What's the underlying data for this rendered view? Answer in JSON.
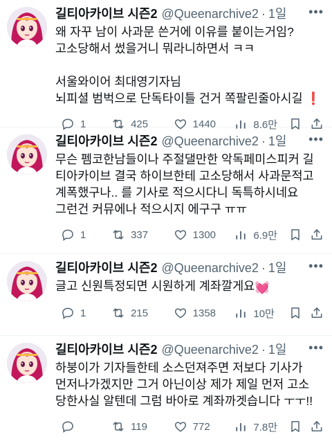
{
  "tweets": [
    {
      "name": "길티아카이브 시즌2",
      "handle": "@Queenarchive2",
      "dot": "·",
      "time": "1일",
      "lines": [
        "왜 자꾸 남이 사과문 쓴거에 이유를 붙이는거임?",
        "고소당해서 썼을거니 뭐라니하면서 ㅋㅋ",
        "",
        "서울와이어 최대영기자님",
        "뇌피셜 범벅으로 단독타이틀 건거 쪽팔린줄아시길"
      ],
      "trailing_emoji": "❗",
      "replies": "1",
      "retweets": "425",
      "likes": "1440",
      "views": "8.6만"
    },
    {
      "name": "길티아카이브 시즌2",
      "handle": "@Queenarchive2",
      "dot": "·",
      "time": "1일",
      "lines": [
        "무슨 펨코한남들이나 주절댈만한 악독페미스피커 길",
        "티아카이브 결국 하이브한테 고소당해서 사과문적고",
        "계폭했구나.. 를 기사로 적으시다니 독특하시네요",
        "그런건 커뮤에나 적으시지 에구구 ㅠㅠ"
      ],
      "replies": "1",
      "retweets": "337",
      "likes": "1300",
      "views": "6.9만"
    },
    {
      "name": "길티아카이브 시즌2",
      "handle": "@Queenarchive2",
      "dot": "·",
      "time": "1일",
      "lines": [
        "글고 신원특정되면 시원하게 계좌깔게요"
      ],
      "trailing_emoji": "💓",
      "replies": "1",
      "retweets": "215",
      "likes": "1358",
      "views": "10만"
    },
    {
      "name": "길티아카이브 시즌2",
      "handle": "@Queenarchive2",
      "dot": "·",
      "time": "1일",
      "lines": [
        "하붕이가 기자들한테 소스던져주면 저보다 기사가",
        "먼저나가겠지만 그거 아닌이상 제가 제일 먼저 고소",
        "당한사실 알텐데 그럼 바아로 계좌까겟습니다 ㅜㅜ!!"
      ],
      "replies": "",
      "retweets": "119",
      "likes": "772",
      "views": "7.8만"
    }
  ],
  "colors": {
    "text": "#0f1419",
    "secondary": "#536471",
    "divider": "#eff3f4",
    "avatar_hair": "#c2185b"
  },
  "icons": [
    "reply-icon",
    "retweet-icon",
    "like-icon",
    "views-icon",
    "bookmark-icon",
    "share-icon",
    "more-icon"
  ]
}
